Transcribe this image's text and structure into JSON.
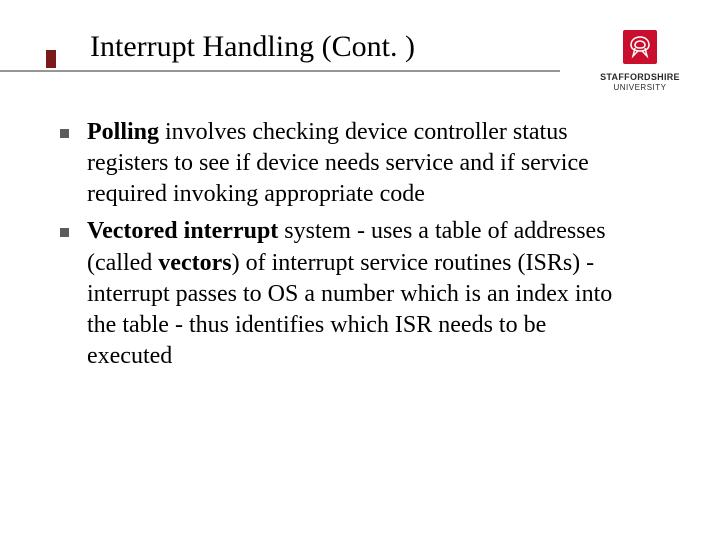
{
  "slide": {
    "title": "Interrupt Handling (Cont. )",
    "logo": {
      "line1": "STAFFORDSHIRE",
      "line2": "UNIVERSITY"
    },
    "bullets": [
      {
        "bold1": "Polling",
        "text1": " involves checking device controller status registers to see if device needs service and if service required invoking appropriate code"
      },
      {
        "bold1": "Vectored interrupt",
        "text1": " system - uses a table of addresses (called ",
        "bold2": "vectors",
        "text2": ") of interrupt service routines (ISRs) - interrupt passes to OS a number which is an index into the table - thus identifies which ISR needs to be executed"
      }
    ]
  }
}
